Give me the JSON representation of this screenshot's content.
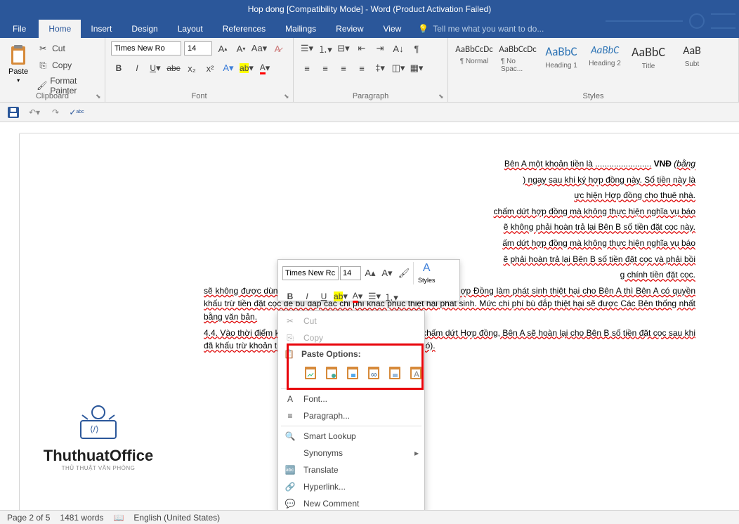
{
  "titlebar": "Hop dong [Compatibility Mode] - Word (Product Activation Failed)",
  "tabs": {
    "file": "File",
    "home": "Home",
    "insert": "Insert",
    "design": "Design",
    "layout": "Layout",
    "references": "References",
    "mailings": "Mailings",
    "review": "Review",
    "view": "View",
    "tellme": "Tell me what you want to do..."
  },
  "ribbon": {
    "clipboard": {
      "label": "Clipboard",
      "paste": "Paste",
      "cut": "Cut",
      "copy": "Copy",
      "formatPainter": "Format Painter"
    },
    "font": {
      "label": "Font",
      "name": "Times New Ro",
      "size": "14"
    },
    "paragraph": {
      "label": "Paragraph"
    },
    "styles": {
      "label": "Styles",
      "items": [
        {
          "preview": "AaBbCcDc",
          "name": "¶ Normal"
        },
        {
          "preview": "AaBbCcDc",
          "name": "¶ No Spac..."
        },
        {
          "preview": "AaBbC",
          "name": "Heading 1"
        },
        {
          "preview": "AaBbC",
          "name": "Heading 2"
        },
        {
          "preview": "AaBbC",
          "name": "Title"
        },
        {
          "preview": "AaB",
          "name": "Subt"
        }
      ]
    }
  },
  "miniToolbar": {
    "font": "Times New Rc",
    "size": "14",
    "stylesLabel": "Styles"
  },
  "contextMenu": {
    "cut": "Cut",
    "copy": "Copy",
    "pasteOptions": "Paste Options:",
    "font": "Font...",
    "paragraph": "Paragraph...",
    "smartLookup": "Smart Lookup",
    "synonyms": "Synonyms",
    "translate": "Translate",
    "hyperlink": "Hyperlink...",
    "newComment": "New Comment"
  },
  "document": {
    "p1a": "Bên A một khoản tiền là ........................",
    "p1b": " VNĐ ",
    "p1c": "(bằng ",
    "p1d": ") ngay sau khi ký hợp đồng này. Số tiền này là",
    "p2": "ực hiện Hợp đồng cho thuê nhà.",
    "p3a": "chấm dứt hợp đồng mà không thực hiện nghĩa vụ báo",
    "p3b": "ẽ không phải hoàn trả lại Bên B số tiền đặt cọc này.",
    "p4a": "ấm dứt hợp đồng mà không thực hiện nghĩa vụ báo",
    "p4b": "ẽ phải hoàn trả lại Bên B số tiền đặt cọc và phải bồi",
    "p4c": "g chính tiền đặt cọc.",
    "p5": "sẽ không được dùng để thanh toán tiền thuê. Nếu Bên B vi phạm Hợp Đồng làm phát sinh thiệt hại cho Bên A thì Bên A có quyền khấu trừ tiền đặt cọc để bù đắp các chi phí khắc phục thiệt hại phát sinh. Mức chi phí bù đắp thiệt hại sẽ được Các Bên thống nhất bằng văn bản.",
    "p6": "4.4. Vào thời điểm kết thúc thời hạn thuê hoặc kể từ ngày chấm dứt Hợp đồng, Bên A sẽ hoàn lại cho Bên B số tiền đặt cọc sau khi đã khấu trừ khoản tiền chi phí để khắc phục thiệt hại (nếu có)."
  },
  "watermark": {
    "text": "ThuthuatOffice",
    "sub": "THỦ THUẬT VĂN PHÒNG"
  },
  "statusbar": {
    "page": "Page 2 of 5",
    "words": "1481 words",
    "lang": "English (United States)"
  }
}
